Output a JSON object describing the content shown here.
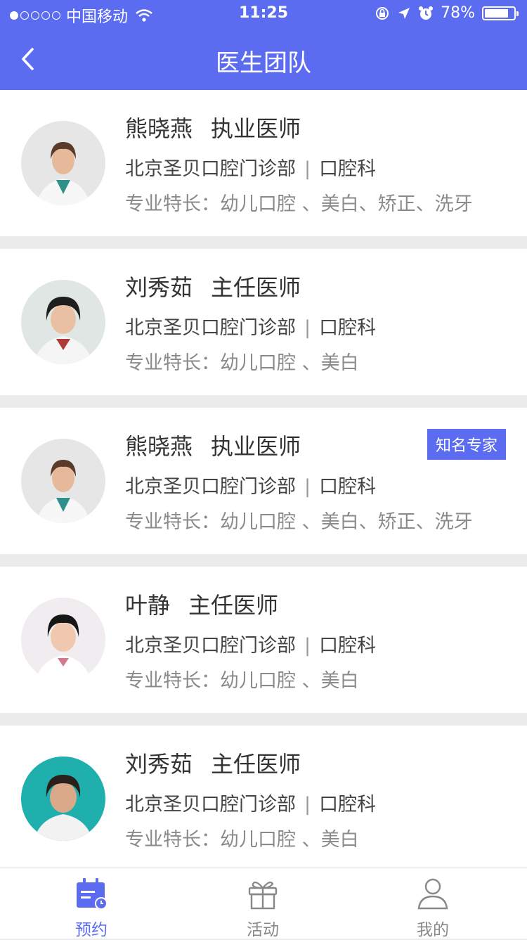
{
  "status_bar": {
    "carrier": "中国移动",
    "time": "11:25",
    "battery": "78%"
  },
  "header": {
    "title": "医生团队"
  },
  "doctors": [
    {
      "name": "熊晓燕",
      "rank": "执业医师",
      "clinic": "北京圣贝口腔门诊部",
      "department": "口腔科",
      "specialty": "专业特长：幼儿口腔 、美白、矫正、洗牙",
      "badge": ""
    },
    {
      "name": "刘秀茹",
      "rank": "主任医师",
      "clinic": "北京圣贝口腔门诊部",
      "department": "口腔科",
      "specialty": "专业特长：幼儿口腔 、美白",
      "badge": ""
    },
    {
      "name": "熊晓燕",
      "rank": "执业医师",
      "clinic": "北京圣贝口腔门诊部",
      "department": "口腔科",
      "specialty": "专业特长：幼儿口腔 、美白、矫正、洗牙",
      "badge": "知名专家"
    },
    {
      "name": "叶静",
      "rank": "主任医师",
      "clinic": "北京圣贝口腔门诊部",
      "department": "口腔科",
      "specialty": "专业特长：幼儿口腔 、美白",
      "badge": ""
    },
    {
      "name": "刘秀茹",
      "rank": "主任医师",
      "clinic": "北京圣贝口腔门诊部",
      "department": "口腔科",
      "specialty": "专业特长：幼儿口腔 、美白",
      "badge": ""
    }
  ],
  "tabbar": [
    {
      "label": "预约",
      "icon": "calendar-icon",
      "active": true
    },
    {
      "label": "活动",
      "icon": "gift-icon",
      "active": false
    },
    {
      "label": "我的",
      "icon": "user-icon",
      "active": false
    }
  ],
  "colors": {
    "primary": "#5b6cf0"
  }
}
